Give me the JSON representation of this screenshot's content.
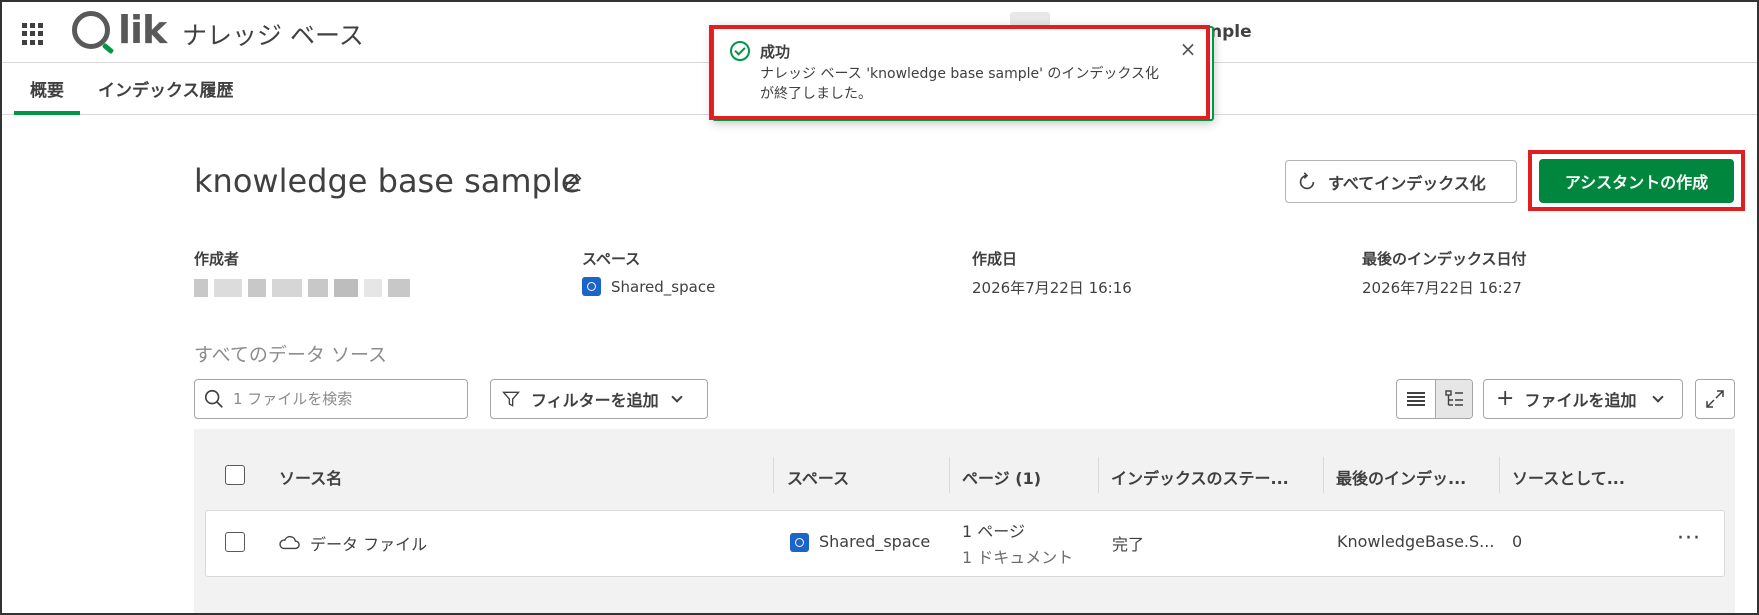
{
  "header": {
    "logo_text": "Qlik",
    "logo_suffix": "lik",
    "app_title": "ナレッジ ベース",
    "trailing_text": "nple"
  },
  "tabs": [
    {
      "label": "概要"
    },
    {
      "label": "インデックス履歴"
    }
  ],
  "toast": {
    "title": "成功",
    "message": "ナレッジ ベース 'knowledge base sample' のインデックス化が終了しました。",
    "close_symbol": "×"
  },
  "kb": {
    "title": "knowledge base sample",
    "index_all_label": "すべてインデックス化",
    "create_assistant_label": "アシスタントの作成"
  },
  "metadata": {
    "creator_label": "作成者",
    "space_label": "スペース",
    "space_value": "Shared_space",
    "created_label": "作成日",
    "created_value": "2026年7月22日 16:16",
    "last_index_label": "最後のインデックス日付",
    "last_index_value": "2026年7月22日 16:27"
  },
  "sources": {
    "title": "すべてのデータ ソース",
    "search_placeholder": "1 ファイルを検索",
    "filter_label": "フィルターを追加",
    "add_file_label": "ファイルを追加",
    "add_symbol": "+",
    "more_symbol": "···",
    "columns": [
      "ソース名",
      "スペース",
      "ページ (1)",
      "インデックスのステー...",
      "最後のインデッ...",
      "ソースとして..."
    ],
    "rows": [
      {
        "name": "データ ファイル",
        "space": "Shared_space",
        "pages": "1 ページ",
        "documents": "1 ドキュメント",
        "status": "完了",
        "last_index": "KnowledgeBase.S...",
        "as_source": "0"
      }
    ]
  },
  "colors": {
    "brand_green": "#009845",
    "primary_button": "#00873d",
    "highlight_red": "#e02020",
    "space_blue": "#1b64c8"
  }
}
